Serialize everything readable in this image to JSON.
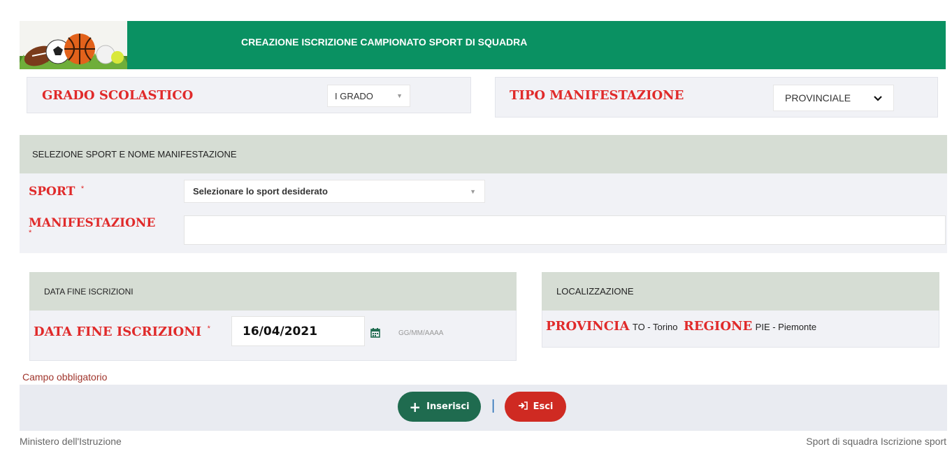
{
  "header": {
    "title": "CREAZIONE ISCRIZIONE CAMPIONATO SPORT DI SQUADRA"
  },
  "grado": {
    "label": "GRADO SCOLASTICO",
    "value": "I GRADO"
  },
  "tipo": {
    "label": "TIPO MANIFESTAZIONE",
    "value": "PROVINCIALE"
  },
  "sport_section": {
    "title": "SELEZIONE SPORT E NOME MANIFESTAZIONE",
    "sport_label": "SPORT",
    "sport_placeholder": "Selezionare lo sport desiderato",
    "manifestazione_label": "MANIFESTAZIONE",
    "manifestazione_value": "",
    "required_mark": "*"
  },
  "data_section": {
    "title": "DATA FINE ISCRIZIONI",
    "label": "DATA FINE ISCRIZIONI",
    "value": "16/04/2021",
    "format_hint": "GG/MM/AAAA"
  },
  "localizzazione": {
    "title": "LOCALIZZAZIONE",
    "provincia_label": "PROVINCIA",
    "provincia_value": "TO - Torino",
    "regione_label": "REGIONE",
    "regione_value": "PIE - Piemonte"
  },
  "required_note": "Campo obbligatorio",
  "actions": {
    "insert_label": "Inserisci",
    "exit_label": "Esci",
    "separator": "|"
  },
  "footer": {
    "left": "Ministero dell'Istruzione",
    "right": "Sport di squadra Iscrizione sport"
  },
  "colors": {
    "header": "#0a9162",
    "insert": "#1f6b4f",
    "exit": "#cf2a22",
    "label_red": "#e02a2a"
  }
}
